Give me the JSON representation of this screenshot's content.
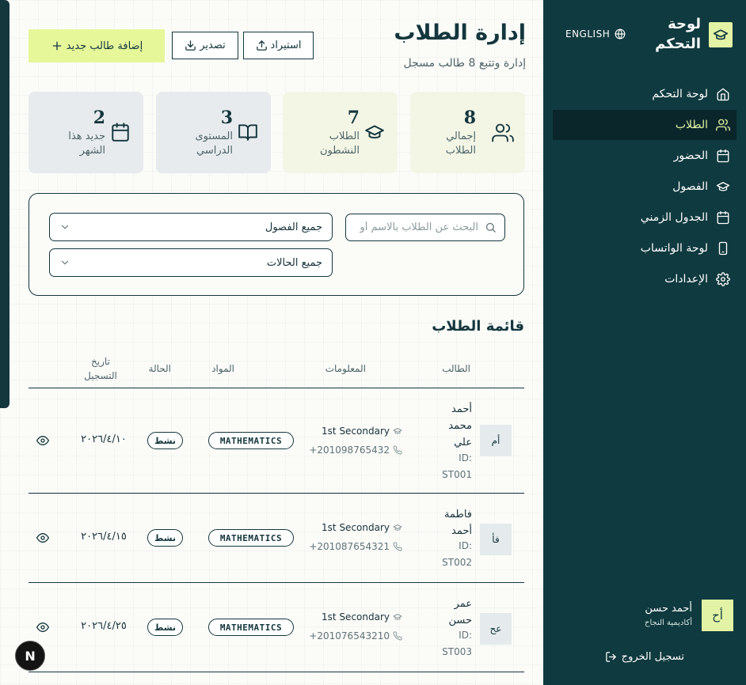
{
  "sidebar": {
    "brand_title": "لوحة التحكم",
    "language_toggle": "ENGLISH",
    "items": [
      {
        "label": "لوحة التحكم",
        "icon": "home-icon"
      },
      {
        "label": "الطلاب",
        "icon": "users-icon",
        "active": true
      },
      {
        "label": "الحضور",
        "icon": "calendar-icon"
      },
      {
        "label": "الفصول",
        "icon": "graduation-cap-icon"
      },
      {
        "label": "الجدول الزمني",
        "icon": "calendar-icon"
      },
      {
        "label": "لوحة الواتساب",
        "icon": "phone-icon"
      },
      {
        "label": "الإعدادات",
        "icon": "gear-icon"
      }
    ],
    "user": {
      "initials": "أح",
      "name": "أحمد حسن",
      "org": "أكاديمية النجاح"
    },
    "logout_label": "تسجيل الخروج"
  },
  "header": {
    "title": "إدارة الطلاب",
    "subtitle": "إدارة وتتبع 8 طالب مسجل",
    "add_label": "إضافة طالب جديد",
    "export_label": "تصدير",
    "import_label": "استيراد"
  },
  "stats": [
    {
      "value": "8",
      "label": "إجمالي الطلاب",
      "icon": "users-icon"
    },
    {
      "value": "7",
      "label": "الطلاب النشطون",
      "icon": "graduation-cap-icon"
    },
    {
      "value": "3",
      "label": "المستوى الدراسي",
      "icon": "book-icon"
    },
    {
      "value": "2",
      "label": "جديد هذا الشهر",
      "icon": "calendar-icon"
    }
  ],
  "filters": {
    "search_placeholder": "البحث عن الطلاب بالاسم أو",
    "class_select": "جميع الفصول",
    "status_select": "جميع الحالات"
  },
  "table": {
    "title": "قائمة الطلاب",
    "columns": {
      "student": "الطالب",
      "info": "المعلومات",
      "subjects": "المواد",
      "status": "الحالة",
      "date": "تاريخ التسجيل"
    },
    "rows": [
      {
        "initials": "أم",
        "name": "أحمد محمد علي",
        "id": "ID: ST001",
        "level": "1st Secondary",
        "phone": "+201098765432",
        "subject": "MATHEMATICS",
        "status": "نشط",
        "date": "٢٠٢٦/٤/١٠"
      },
      {
        "initials": "فأ",
        "name": "فاطمة أحمد",
        "id": "ID: ST002",
        "level": "1st Secondary",
        "phone": "+201087654321",
        "subject": "MATHEMATICS",
        "status": "نشط",
        "date": "٢٠٢٦/٤/١٥"
      },
      {
        "initials": "عح",
        "name": "عمر حسن",
        "id": "ID: ST003",
        "level": "1st Secondary",
        "phone": "+201076543210",
        "subject": "MATHEMATICS",
        "status": "نشط",
        "date": "٢٠٢٦/٤/٢٥"
      }
    ]
  },
  "dev_badge": "N",
  "colors": {
    "sidebar_bg": "#0f3a3f",
    "accent": "#e6f79a",
    "text_dark": "#14363d"
  }
}
